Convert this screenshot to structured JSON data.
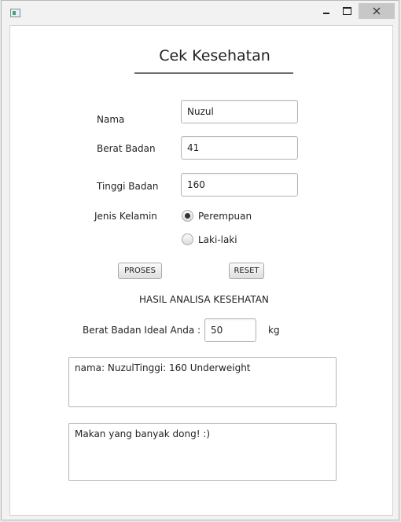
{
  "window": {
    "icon": "java-app-icon",
    "controls": [
      "minimize-icon",
      "maximize-icon",
      "close-icon"
    ]
  },
  "form": {
    "title": "Cek Kesehatan",
    "nama_label": "Nama",
    "nama_value": "Nuzul",
    "berat_label": "Berat Badan",
    "berat_value": "41",
    "tinggi_label": "Tinggi Badan",
    "tinggi_value": "160",
    "gender_label": "Jenis Kelamin",
    "gender_options": [
      {
        "label": "Perempuan",
        "selected": true
      },
      {
        "label": "Laki-laki",
        "selected": false
      }
    ],
    "proses_label": "PROSES",
    "reset_label": "RESET"
  },
  "result": {
    "heading": "HASIL ANALISA KESEHATAN",
    "ideal_label": "Berat Badan Ideal Anda :",
    "ideal_value": "50",
    "ideal_unit": "kg",
    "summary_text": "nama:  NuzulTinggi:  160 Underweight",
    "advice_text": "Makan yang banyak dong! :)"
  }
}
